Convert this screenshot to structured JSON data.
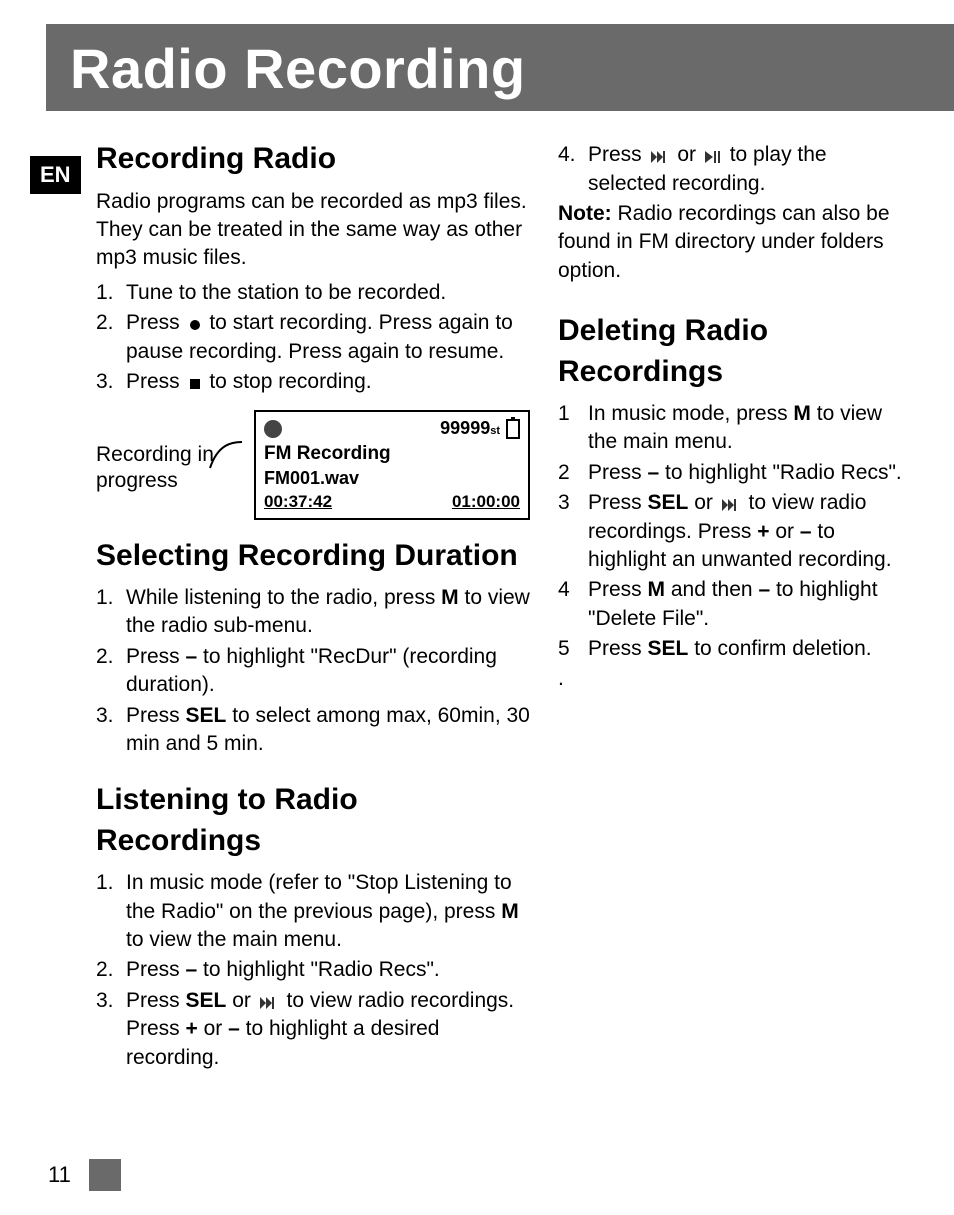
{
  "lang_tag": "EN",
  "title": "Radio Recording",
  "page_number": "11",
  "s1": {
    "heading": "Recording Radio",
    "intro": "Radio programs can be recorded as mp3 files. They can be treated in the same way as other mp3 music files.",
    "step1_num": "1.",
    "step1": "Tune to the station to be recorded.",
    "step2_num": "2.",
    "step2a": "Press ",
    "step2b": " to start recording. Press again to pause recording. Press again to resume.",
    "step3_num": "3.",
    "step3a": "Press ",
    "step3b": "  to stop recording."
  },
  "fig": {
    "label": "Recording in progress",
    "count": "99999",
    "count_sub": "st",
    "title": "FM Recording",
    "file": "FM001.wav",
    "t1": "00:37:42",
    "t2": "01:00:00"
  },
  "s2": {
    "heading": "Selecting Recording Duration",
    "step1_num": "1.",
    "step1a": "While listening to the radio, press ",
    "step1_m": "M",
    "step1b": " to view the radio sub-menu.",
    "step2_num": "2.",
    "step2a": "Press ",
    "step2_sym": "–",
    "step2b": " to highlight \"RecDur\" (recording duration).",
    "step3_num": "3.",
    "step3a": "Press ",
    "step3_sel": "SEL",
    "step3b": " to select among max, 60min, 30 min and 5 min."
  },
  "s3": {
    "heading": "Listening to Radio Recordings",
    "step1_num": "1.",
    "step1a": "In music mode (refer to \"Stop Listening to the Radio\" on the previous page), press ",
    "step1_m": "M",
    "step1b": " to view the main menu.",
    "step2_num": "2.",
    "step2a": "Press ",
    "step2_sym": "–",
    "step2b": " to highlight \"Radio Recs\".",
    "step3_num": "3.",
    "step3a": "Press ",
    "step3_sel": "SEL",
    "step3_or": " or ",
    "step3b": "  to view radio recordings. Press ",
    "step3_plus": "+",
    "step3_or2": " or ",
    "step3_minus": "–",
    "step3c": " to highlight a desired recording."
  },
  "s3b": {
    "step4_num": "4.",
    "step4a": "Press  ",
    "step4_or": "  or  ",
    "step4b": "  to play the selected recording.",
    "note_label": "Note:",
    "note": " Radio recordings can also be found in FM directory under folders option."
  },
  "s4": {
    "heading": "Deleting Radio Recordings",
    "step1_num": "1",
    "step1a": "In music mode, press ",
    "step1_m": "M",
    "step1b": " to view the main menu.",
    "step2_num": "2",
    "step2a": "Press ",
    "step2_sym": "–",
    "step2b": " to highlight \"Radio Recs\".",
    "step3_num": "3",
    "step3a": "Press ",
    "step3_sel": "SEL",
    "step3_or": " or ",
    "step3b": "  to view radio recordings. Press ",
    "step3_plus": "+",
    "step3_or2": " or ",
    "step3_minus": "–",
    "step3c": " to highlight an unwanted recording.",
    "step4_num": "4",
    "step4a": "Press ",
    "step4_m": "M",
    "step4_and": " and then ",
    "step4_sym": "–",
    "step4b": " to highlight \"Delete File\".",
    "step5_num": "5",
    "step5a": "Press ",
    "step5_sel": "SEL",
    "step5b": " to confirm deletion.",
    "trailing_dot": "."
  }
}
